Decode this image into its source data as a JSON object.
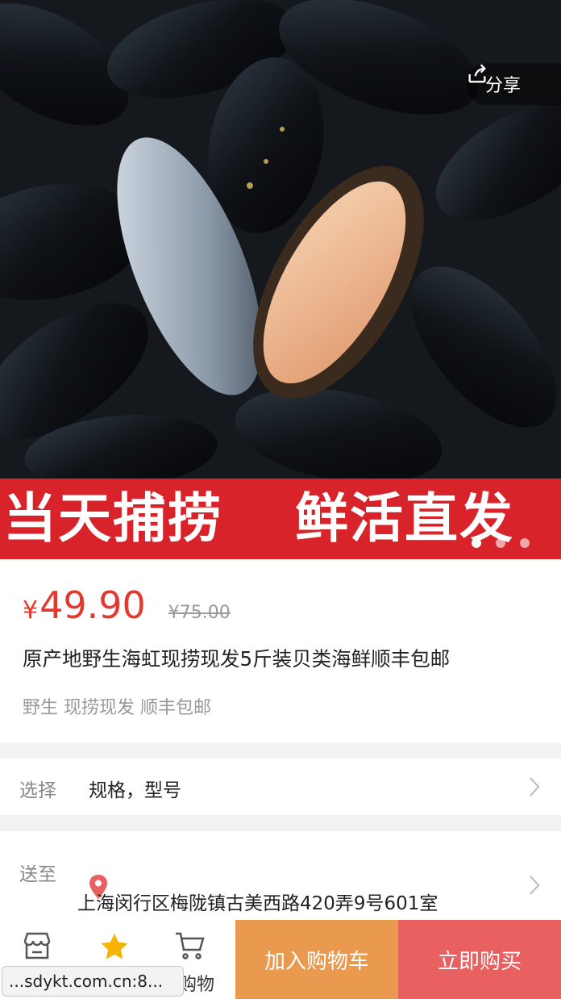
{
  "hero": {
    "share_label": "分享",
    "banner_left": "当天捕捞",
    "banner_right": "鲜活直发",
    "carousel_count": 3,
    "carousel_active": 1
  },
  "product": {
    "currency": "¥",
    "price": "49.90",
    "original_price": "¥75.00",
    "title": "原产地野生海虹现捞现发5斤装贝类海鲜顺丰包邮",
    "tags": "野生 现捞现发 顺丰包邮"
  },
  "select": {
    "label": "选择",
    "value": "规格，型号"
  },
  "shipping": {
    "label": "送至",
    "address": "上海闵行区梅陇镇古美西路420弄9号601室"
  },
  "bottom_bar": {
    "cart_partial_label": "购物",
    "add_to_cart": "加入购物车",
    "buy_now": "立即购买"
  },
  "url_tooltip": "...sdykt.com.cn:8...",
  "colors": {
    "price_red": "#e23a2f",
    "banner_red": "#d8232a",
    "add_cart_orange": "#ea9a4e",
    "buy_now_red": "#e86060",
    "star_yellow": "#f5b400"
  },
  "icons": [
    "share-icon",
    "shop-icon",
    "star-icon",
    "cart-icon",
    "chevron-right-icon",
    "location-pin-icon"
  ]
}
